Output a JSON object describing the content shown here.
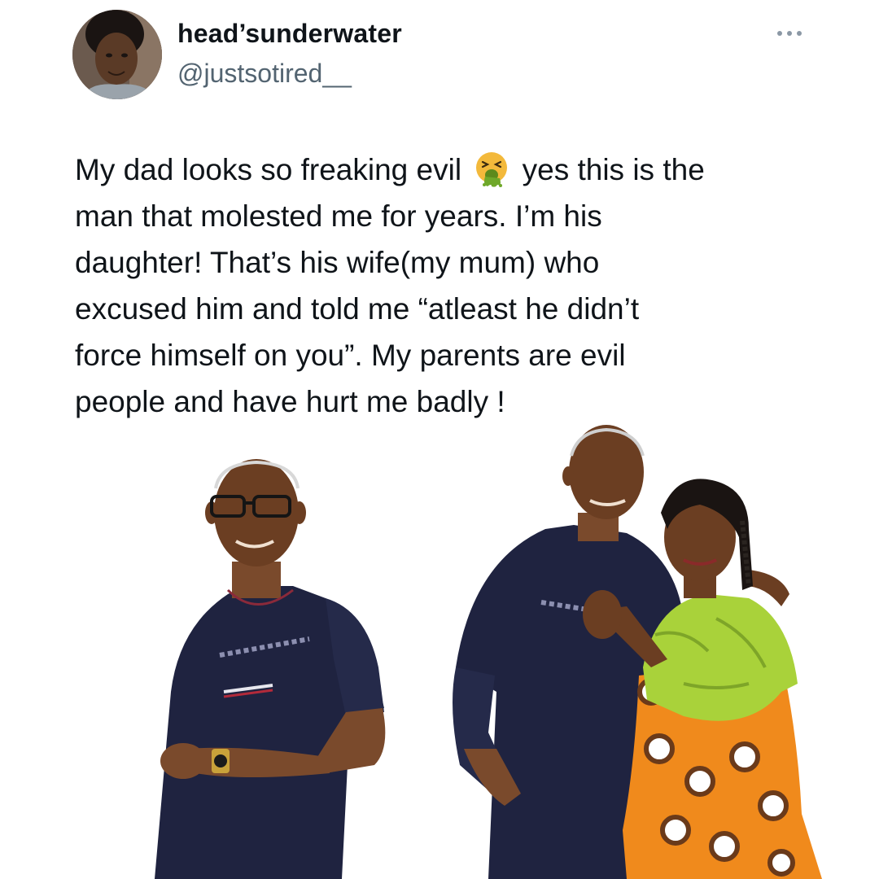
{
  "tweet": {
    "display_name": "head’sunderwater",
    "handle": "@justsotired__",
    "text_lines": [
      {
        "before": "My dad looks so freaking evil",
        "emoji": "face-vomiting-emoji",
        "after": "yes this is the"
      },
      {
        "text": "man that molested me for years. I’m his"
      },
      {
        "text": "daughter! That’s his wife(my mum) who"
      },
      {
        "text": "excused him and told me “atleast he didn’t"
      },
      {
        "text": "force himself on you”. My parents are evil"
      },
      {
        "text": "people and have hurt me badly !"
      }
    ]
  },
  "icons": {
    "more": "more-options-icon",
    "emoji": "face-vomiting-emoji"
  },
  "colors": {
    "text": "#0f1419",
    "secondary": "#536471",
    "shirt": "#1f2340",
    "dress_green": "#a9d23a",
    "dress_orange": "#f08a1c"
  }
}
